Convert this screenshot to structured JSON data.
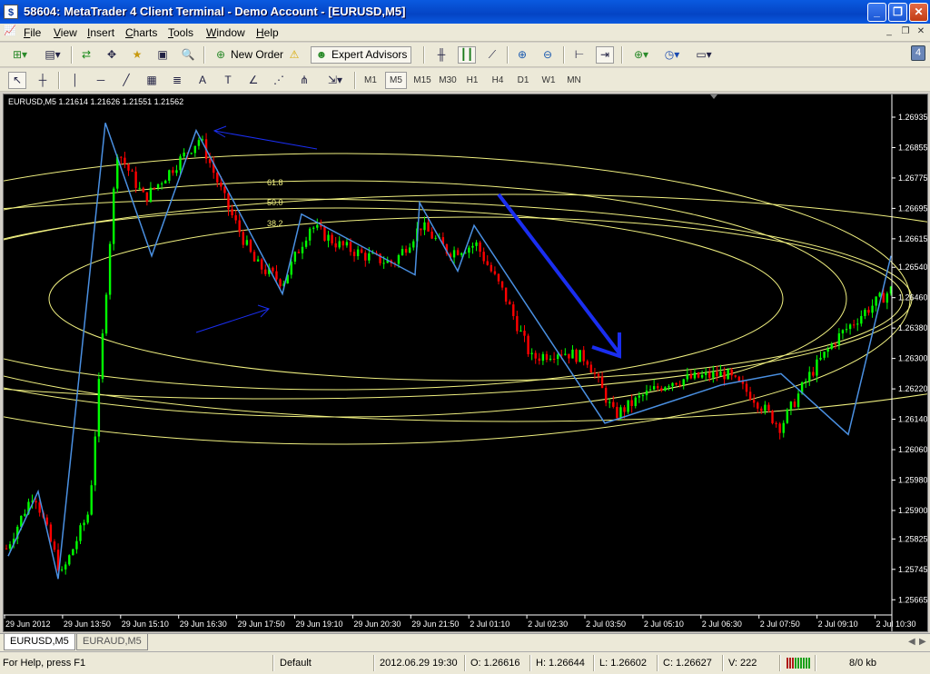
{
  "window": {
    "title": "58604: MetaTrader 4 Client Terminal - Demo Account - [EURUSD,M5]",
    "app_icon": "metatrader-logo",
    "controls": [
      "minimize-icon",
      "restore-icon",
      "close-icon"
    ]
  },
  "menu": {
    "items": [
      {
        "label": "File",
        "u": "F",
        "rest": "ile"
      },
      {
        "label": "View",
        "u": "V",
        "rest": "iew"
      },
      {
        "label": "Insert",
        "u": "I",
        "rest": "nsert"
      },
      {
        "label": "Charts",
        "u": "C",
        "rest": "harts"
      },
      {
        "label": "Tools",
        "u": "T",
        "rest": "ools"
      },
      {
        "label": "Window",
        "u": "W",
        "rest": "indow"
      },
      {
        "label": "Help",
        "u": "H",
        "rest": "elp"
      }
    ]
  },
  "toolbar": {
    "new_order": "New Order",
    "expert_advisors": "Expert Advisors",
    "badge": "4"
  },
  "timeframes": [
    "M1",
    "M5",
    "M15",
    "M30",
    "H1",
    "H4",
    "D1",
    "W1",
    "MN"
  ],
  "active_timeframe": "M5",
  "chart": {
    "info": "EURUSD,M5  1.21614 1.21626 1.21551 1.21562",
    "fib_levels": [
      "61.8",
      "50.0",
      "38.2"
    ],
    "colors": {
      "bull": "#00ff00",
      "bear": "#ff0000",
      "zigzag": "#4a90e2",
      "fib": "#f0f080",
      "arrow": "#1a2ef0",
      "bg": "#000000",
      "axis_text": "#ffffff"
    }
  },
  "chart_data": {
    "type": "candlestick",
    "symbol": "EURUSD",
    "timeframe": "M5",
    "ylim": [
      1.25625,
      1.2699
    ],
    "y_ticks": [
      "1.26935",
      "1.26855",
      "1.26775",
      "1.26695",
      "1.26615",
      "1.26540",
      "1.26460",
      "1.26380",
      "1.26300",
      "1.26220",
      "1.26140",
      "1.26060",
      "1.25980",
      "1.25900",
      "1.25825",
      "1.25745",
      "1.25665"
    ],
    "x_ticks": [
      "29 Jun 2012",
      "29 Jun 13:50",
      "29 Jun 15:10",
      "29 Jun 16:30",
      "29 Jun 17:50",
      "29 Jun 19:10",
      "29 Jun 20:30",
      "29 Jun 21:50",
      "2 Jul 01:10",
      "2 Jul 02:30",
      "2 Jul 03:50",
      "2 Jul 05:10",
      "2 Jul 06:30",
      "2 Jul 07:50",
      "2 Jul 09:10",
      "2 Jul 10:30"
    ],
    "zigzag_prices": [
      1.2578,
      1.2595,
      1.2572,
      1.2692,
      1.2657,
      1.269,
      1.2647,
      1.2668,
      1.2652,
      1.2671,
      1.2653,
      1.2665,
      1.2613,
      1.2623,
      1.2626,
      1.261,
      1.2657
    ],
    "approx_close_path": [
      1.258,
      1.2595,
      1.2573,
      1.259,
      1.2685,
      1.2672,
      1.268,
      1.2688,
      1.267,
      1.2655,
      1.265,
      1.2665,
      1.266,
      1.2657,
      1.2655,
      1.2665,
      1.2658,
      1.266,
      1.2647,
      1.263,
      1.2632,
      1.263,
      1.2615,
      1.262,
      1.2624,
      1.2625,
      1.2626,
      1.262,
      1.2612,
      1.2625,
      1.2635,
      1.2642,
      1.2648
    ]
  },
  "tabs": [
    {
      "label": "EURUSD,M5",
      "active": true
    },
    {
      "label": "EURAUD,M5",
      "active": false
    }
  ],
  "status": {
    "help": "For Help, press F1",
    "profile": "Default",
    "datetime": "2012.06.29 19:30",
    "open": "O: 1.26616",
    "high": "H: 1.26644",
    "low": "L: 1.26602",
    "close": "C: 1.26627",
    "volume": "V: 222",
    "traffic": "8/0 kb"
  }
}
